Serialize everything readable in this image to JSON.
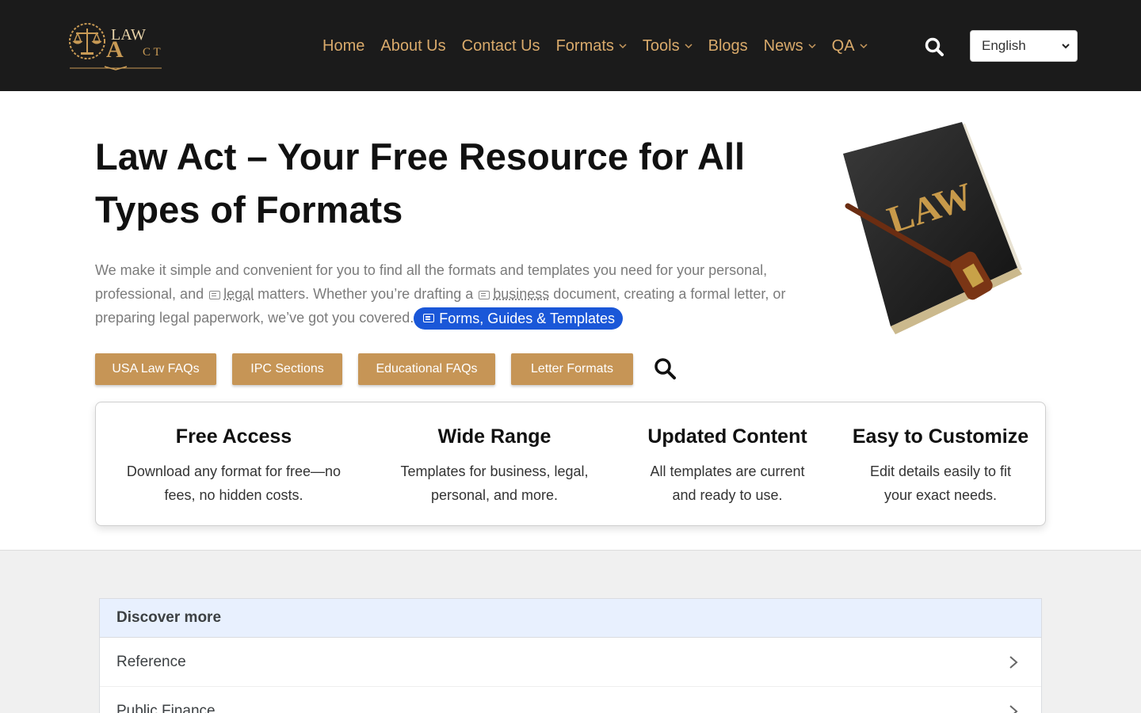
{
  "header": {
    "logo_text_top": "LAW",
    "logo_text_bottom": "ACT",
    "nav": [
      {
        "label": "Home",
        "dropdown": false
      },
      {
        "label": "About Us",
        "dropdown": false
      },
      {
        "label": "Contact Us",
        "dropdown": false
      },
      {
        "label": "Formats",
        "dropdown": true
      },
      {
        "label": "Tools",
        "dropdown": true
      },
      {
        "label": "Blogs",
        "dropdown": false
      },
      {
        "label": "News",
        "dropdown": true
      },
      {
        "label": "QA",
        "dropdown": true
      }
    ],
    "search_icon": "search-icon",
    "language": "English"
  },
  "hero": {
    "title": "Law Act – Your Free Resource for All Types of Formats",
    "text_1": "We make it simple and convenient for you to find all the formats and templates you need for your personal, professional, and ",
    "kw_1": "legal",
    "text_2": " matters. Whether you’re drafting a ",
    "kw_2": "business",
    "text_3": " document, creating a formal letter, or preparing legal paperwork, we’ve got you covered.",
    "pill": "Forms, Guides & Templates",
    "book_label": "LAW"
  },
  "buttons": [
    {
      "label": "USA Law FAQs"
    },
    {
      "label": "IPC Sections"
    },
    {
      "label": "Educational FAQs"
    },
    {
      "label": "Letter Formats"
    }
  ],
  "features": [
    {
      "title": "Free Access",
      "line1": "Download any format for free—no",
      "line2": "fees, no hidden costs."
    },
    {
      "title": "Wide Range",
      "line1": "Templates for business, legal,",
      "line2": "personal, and more."
    },
    {
      "title": "Updated Content",
      "line1": "All templates are current",
      "line2": "and ready to use."
    },
    {
      "title": "Easy to Customize",
      "line1": "Edit details easily to fit",
      "line2": "your exact needs."
    }
  ],
  "discover": {
    "title": "Discover more",
    "items": [
      {
        "label": "Reference"
      },
      {
        "label": "Public Finance"
      }
    ]
  },
  "colors": {
    "header_bg": "#1b1b1b",
    "nav_gold": "#d9aa6b",
    "button_gold": "#c69556",
    "pill_blue": "#1a57d8"
  }
}
